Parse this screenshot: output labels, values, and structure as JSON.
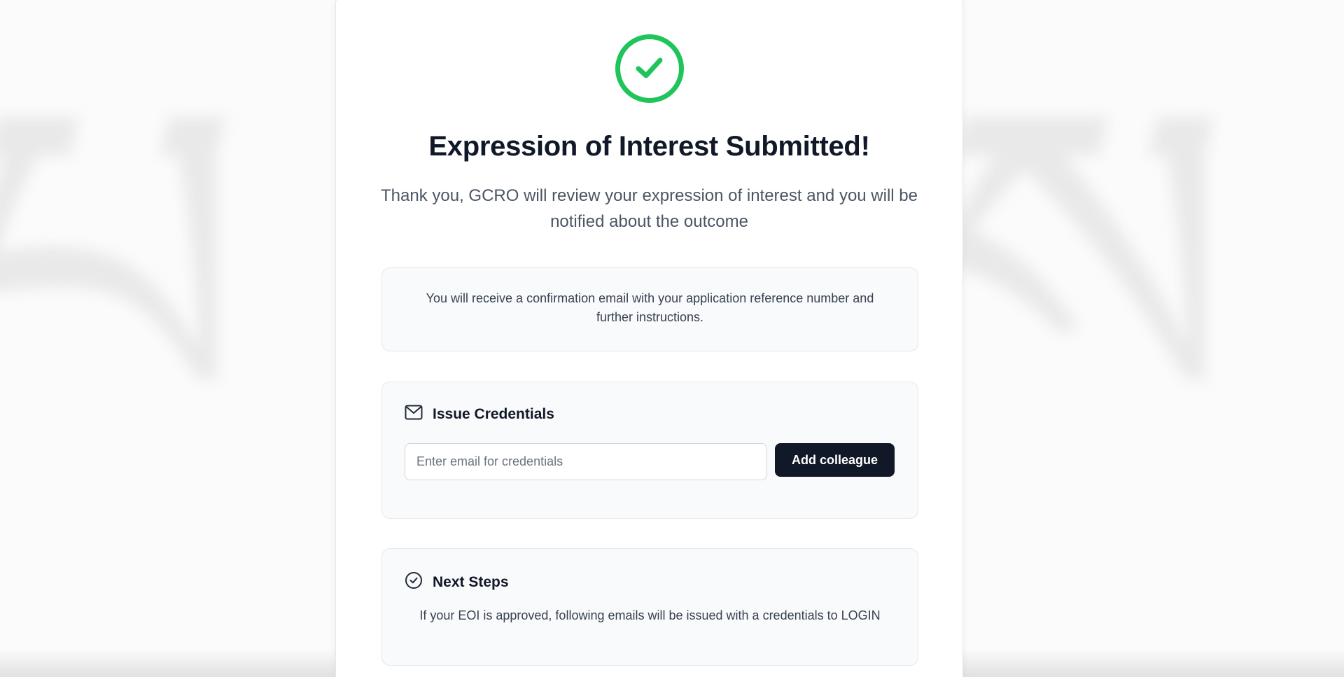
{
  "confirmation": {
    "title": "Expression of Interest Submitted!",
    "subtitle": "Thank you, GCRO will review your expression of interest and you will be notified about the outcome",
    "info_text": "You will receive a confirmation email with your application reference number and further instructions.",
    "success_color": "#1fc45b",
    "status_icon": "check-circle-icon"
  },
  "credentials": {
    "heading": "Issue Credentials",
    "icon": "mail-icon",
    "email_value": "",
    "email_placeholder": "Enter email for credentials",
    "add_button_label": "Add colleague"
  },
  "next_steps": {
    "heading": "Next Steps",
    "icon": "check-circle-outline-icon",
    "text": "If your EOI is approved, following emails will be issued with a credentials to LOGIN"
  }
}
